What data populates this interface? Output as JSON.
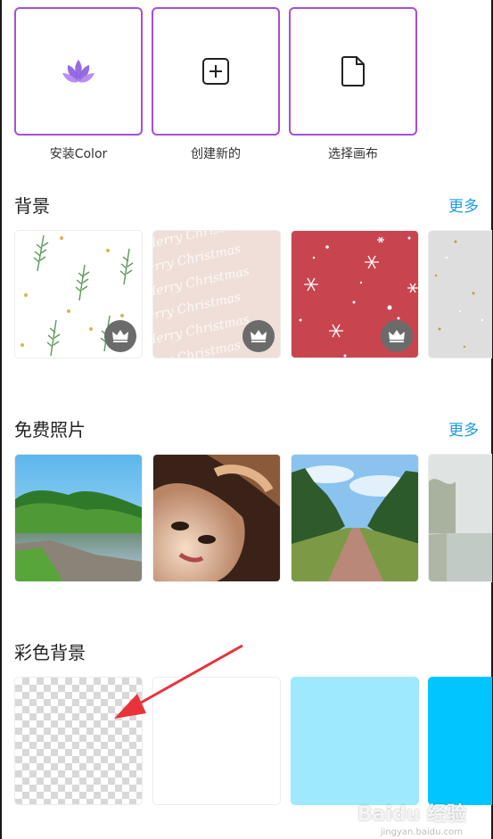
{
  "actions": [
    {
      "label": "安装Color",
      "icon": "lotus-icon"
    },
    {
      "label": "创建新的",
      "icon": "plus-square-icon"
    },
    {
      "label": "选择画布",
      "icon": "document-icon"
    }
  ],
  "sections": {
    "backgrounds": {
      "title": "背景",
      "more": "更多"
    },
    "free_photos": {
      "title": "免费照片",
      "more": "更多"
    },
    "color_backgrounds": {
      "title": "彩色背景"
    }
  },
  "background_items": [
    {
      "name": "leaves-pattern",
      "premium": true
    },
    {
      "name": "merry-christmas-pattern",
      "premium": true,
      "pattern_text": "Merry Christmas"
    },
    {
      "name": "red-snowflake-pattern",
      "premium": true
    },
    {
      "name": "gray-dots-pattern",
      "premium": false
    }
  ],
  "photo_items": [
    {
      "name": "lake-photo"
    },
    {
      "name": "portrait-photo"
    },
    {
      "name": "tree-avenue-photo"
    },
    {
      "name": "misty-river-photo"
    }
  ],
  "color_items": [
    {
      "name": "transparent-color"
    },
    {
      "name": "white-color",
      "color": "#ffffff"
    },
    {
      "name": "light-blue-color",
      "color": "#9ee9fb"
    },
    {
      "name": "cyan-color",
      "color": "#00c6ff"
    }
  ],
  "colors": {
    "accent": "#a64fd6",
    "link": "#1e9be6"
  },
  "watermark": {
    "text": "Baidu 经验",
    "sub": "jingyan.baidu.com"
  }
}
